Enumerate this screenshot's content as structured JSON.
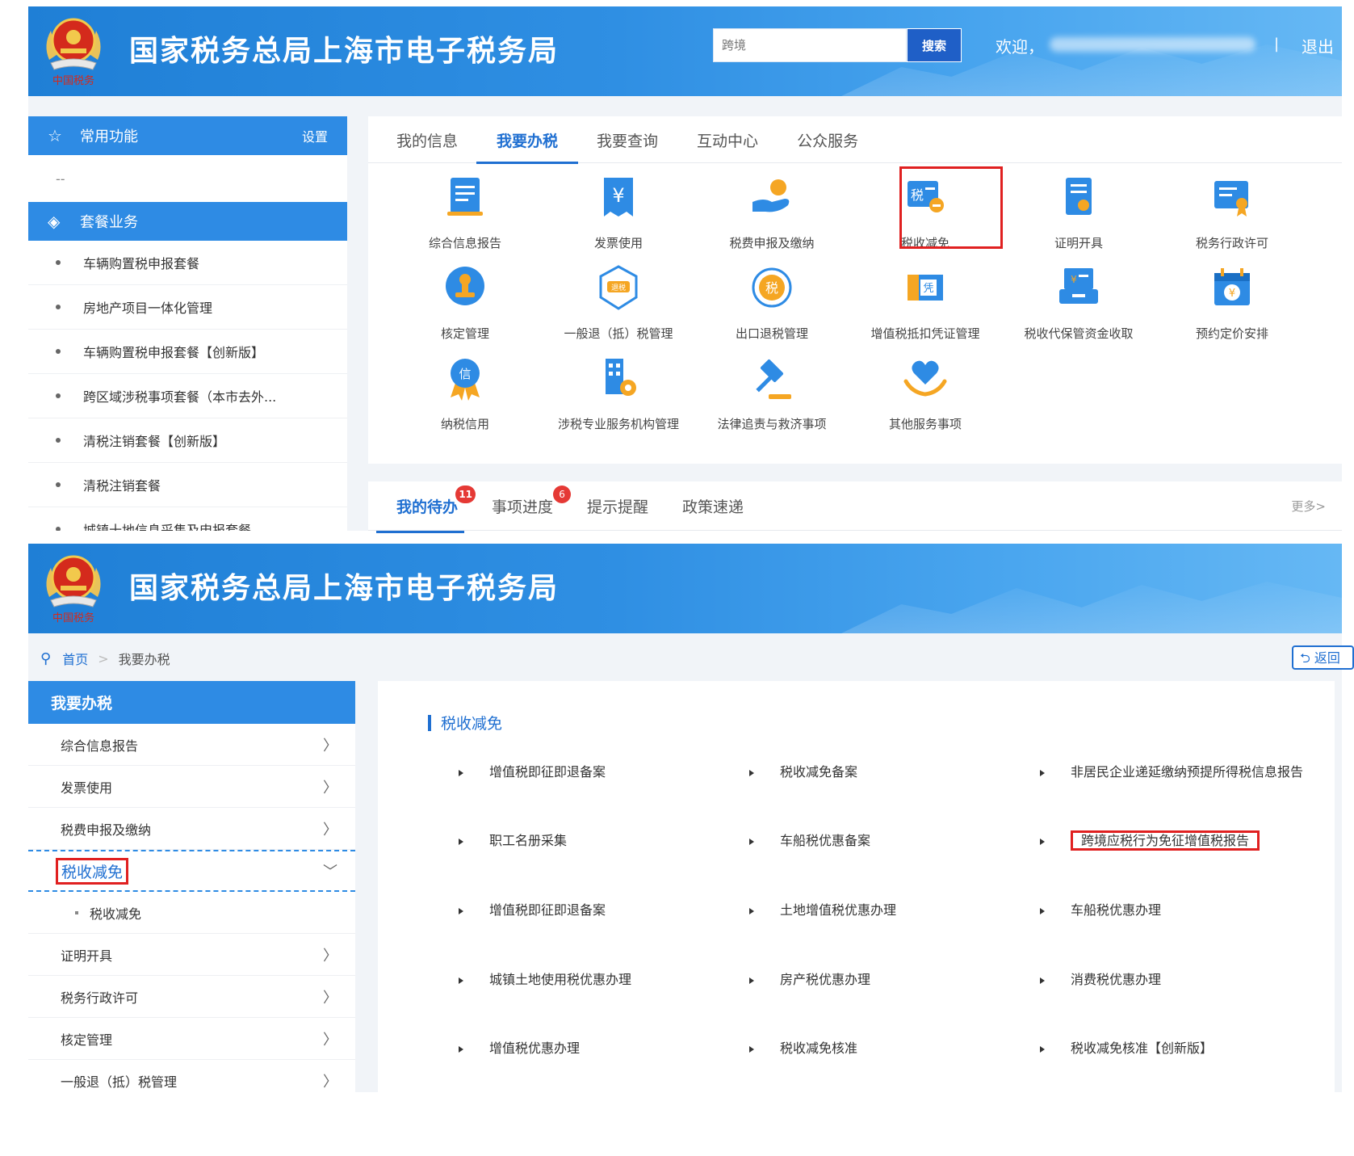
{
  "site": {
    "title": "国家税务总局上海市电子税务局",
    "emblem_caption": "中国税务"
  },
  "top_header": {
    "search_placeholder": "跨境",
    "search_button": "搜索",
    "welcome": "欢迎，",
    "separator": "|",
    "logout": "退出"
  },
  "panel1": {
    "sidebar": {
      "common_functions": "常用功能",
      "settings": "设置",
      "empty": "--",
      "package_services": "套餐业务",
      "items": [
        "车辆购置税申报套餐",
        "房地产项目一体化管理",
        "车辆购置税申报套餐【创新版】",
        "跨区域涉税事项套餐（本市去外...",
        "清税注销套餐【创新版】",
        "清税注销套餐",
        "城镇十地信息采集及申报套餐"
      ]
    },
    "tabs": [
      "我的信息",
      "我要办税",
      "我要查询",
      "互动中心",
      "公众服务"
    ],
    "active_tab": "我要办税",
    "services": [
      {
        "label": "综合信息报告",
        "icon": "document-icon"
      },
      {
        "label": "发票使用",
        "icon": "invoice-yen-icon"
      },
      {
        "label": "税费申报及缴纳",
        "icon": "hand-coin-icon"
      },
      {
        "label": "税收减免",
        "icon": "tax-reduction-icon"
      },
      {
        "label": "证明开具",
        "icon": "certificate-icon"
      },
      {
        "label": "税务行政许可",
        "icon": "permit-icon"
      },
      {
        "label": "核定管理",
        "icon": "stamp-icon"
      },
      {
        "label": "一般退（抵）税管理",
        "icon": "refund-icon"
      },
      {
        "label": "出口退税管理",
        "icon": "export-refund-icon"
      },
      {
        "label": "增值税抵扣凭证管理",
        "icon": "voucher-icon"
      },
      {
        "label": "税收代保管资金收取",
        "icon": "custody-icon"
      },
      {
        "label": "预约定价安排",
        "icon": "calendar-yen-icon"
      },
      {
        "label": "纳税信用",
        "icon": "credit-medal-icon"
      },
      {
        "label": "涉税专业服务机构管理",
        "icon": "building-gear-icon"
      },
      {
        "label": "法律追责与救济事项",
        "icon": "gavel-icon"
      },
      {
        "label": "其他服务事项",
        "icon": "heart-hands-icon"
      }
    ],
    "todo_tabs": [
      {
        "label": "我的待办",
        "badge": "11"
      },
      {
        "label": "事项进度",
        "badge": "6"
      },
      {
        "label": "提示提醒",
        "badge": ""
      },
      {
        "label": "政策速递",
        "badge": ""
      }
    ],
    "more": "更多>"
  },
  "panel2": {
    "breadcrumb": {
      "home": "首页",
      "current": "我要办税"
    },
    "back_button": "返回",
    "sidebar": {
      "title": "我要办税",
      "items": [
        {
          "label": "综合信息报告",
          "chev": "〉"
        },
        {
          "label": "发票使用",
          "chev": "〉"
        },
        {
          "label": "税费申报及缴纳",
          "chev": "〉"
        },
        {
          "label": "税收减免",
          "chev": "﹀"
        },
        {
          "label": "证明开具",
          "chev": "〉"
        },
        {
          "label": "税务行政许可",
          "chev": "〉"
        },
        {
          "label": "核定管理",
          "chev": "〉"
        },
        {
          "label": "一般退（抵）税管理",
          "chev": "〉"
        }
      ],
      "sub_item": "税收减免"
    },
    "section_title": "税收减免",
    "links": [
      "增值税即征即退备案",
      "税收减免备案",
      "非居民企业递延缴纳预提所得税信息报告",
      "职工名册采集",
      "车船税优惠备案",
      "跨境应税行为免征增值税报告",
      "增值税即征即退备案",
      "土地增值税优惠办理",
      "车船税优惠办理",
      "城镇土地使用税优惠办理",
      "房产税优惠办理",
      "消费税优惠办理",
      "增值税优惠办理",
      "税收减免核准",
      "税收减免核准【创新版】"
    ]
  },
  "colors": {
    "header_blue": "#2f8fe3",
    "accent_blue": "#1f6fd1",
    "highlight_red": "#e02020",
    "badge_red": "#e53935"
  }
}
